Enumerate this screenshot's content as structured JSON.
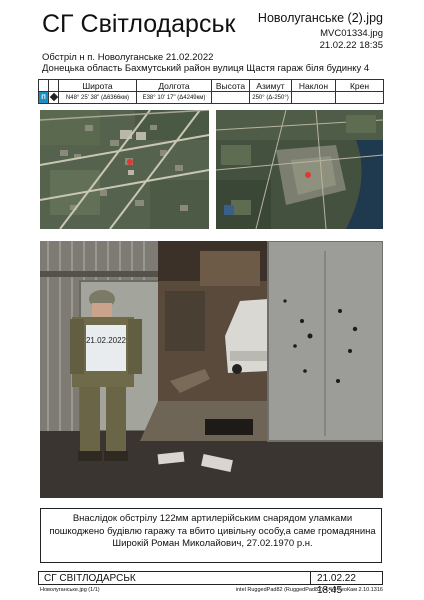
{
  "header": {
    "title": "СГ Світлодарськ",
    "filename": "Новолуганське (2).jpg",
    "source_file": "MVC01334.jpg",
    "datetime": "21.02.22 18:35",
    "location_line1": "Обстріл н п. Новолуганське 21.02.2022",
    "location_line2": "Донецька область Бахмутський район вулиця Щастя гараж біля будинку 4"
  },
  "coords_table": {
    "headers": [
      "Широта",
      "Долгота",
      "Высота",
      "Азимут",
      "Наклон",
      "Крен"
    ],
    "marker": "П",
    "values": [
      "N48° 25' 38\" (Δ6366км)",
      "E38° 10' 17\" (Δ4249км)",
      "",
      "250° (Δ-250°)",
      "",
      ""
    ]
  },
  "images": {
    "map_left": "satellite map (zoomed)",
    "map_right": "satellite map (wide)",
    "main_photo": "photo of damaged garage with soldier holding sign",
    "sign_text": "21.02.2022"
  },
  "caption": "Внаслідок обстрілу 122мм артилерійським снарядом уламками пошкоджено будівлю гаражу та вбито цивільну особу,а саме громадянина Широкій Роман Миколайович, 27.02.1970 р.н.",
  "footer": {
    "left": "СГ СВІТЛОДАРСЬК",
    "right": "21.02.22 18:45",
    "small_left": "Новолуганське.jpg (1/1)",
    "small_right": "intel RuggedPad82 (RuggedPad82) 4:4.4 ГеоКам 2.10.1316"
  },
  "colors": {
    "marker_bg": "#1a8fc7",
    "map_green": "#4c5846",
    "photo_dark": "#2e2a25"
  }
}
